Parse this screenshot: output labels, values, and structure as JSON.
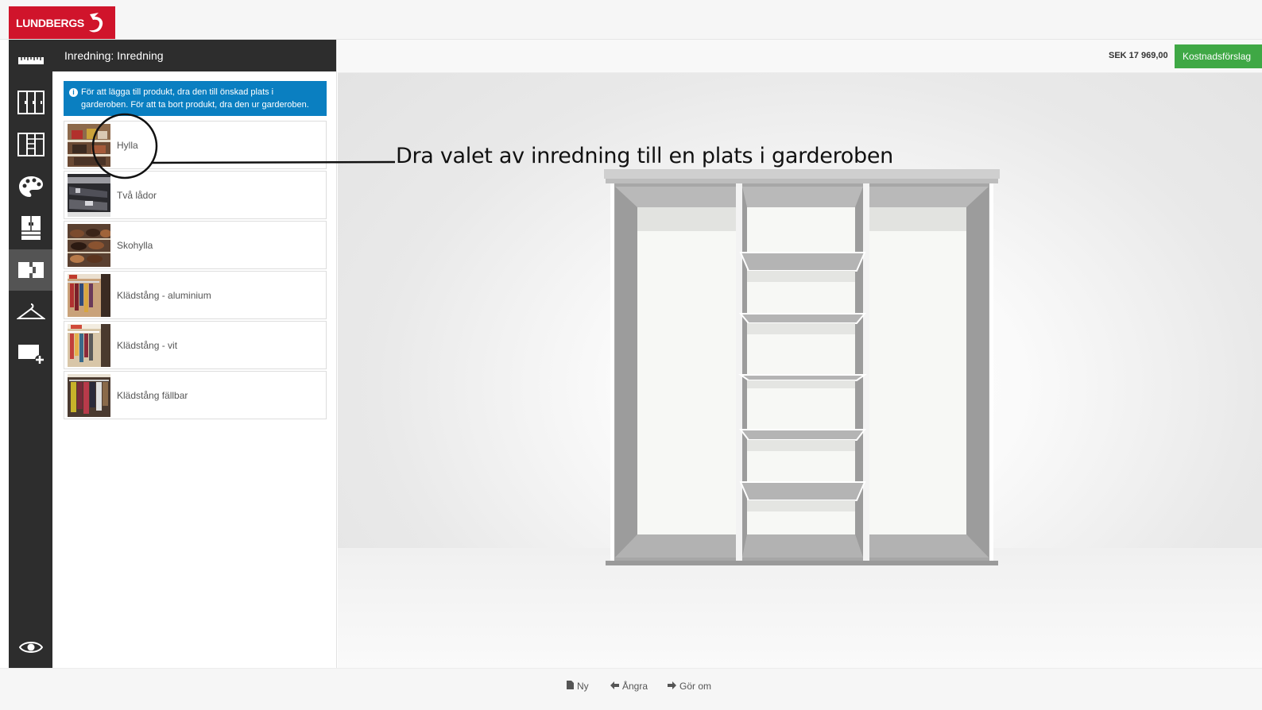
{
  "brand": {
    "name": "LUNDBERGS"
  },
  "rail": {
    "items": [
      {
        "icon": "ruler-icon"
      },
      {
        "icon": "doors-icon"
      },
      {
        "icon": "frame-icon"
      },
      {
        "icon": "palette-icon"
      },
      {
        "icon": "cabinet-icon"
      },
      {
        "icon": "interior-icon",
        "active": true
      },
      {
        "icon": "hanger-icon"
      },
      {
        "icon": "add-panel-icon"
      }
    ],
    "bottom_icon": "eye-icon"
  },
  "panel": {
    "title": "Inredning: Inredning",
    "info_text": "För att lägga till produkt, dra den till önskad plats i garderoben. För att ta bort produkt, dra den ur garderoben.",
    "items": [
      {
        "label": "Hylla"
      },
      {
        "label": "Två lådor"
      },
      {
        "label": "Skohylla"
      },
      {
        "label": "Klädstång - aluminium"
      },
      {
        "label": "Klädstång - vit"
      },
      {
        "label": "Klädstång fällbar"
      }
    ]
  },
  "header": {
    "price": "SEK 17 969,00",
    "quote_button": "Kostnadsförslag"
  },
  "annotation": {
    "text": "Dra valet av inredning till en plats i garderoben"
  },
  "footer": {
    "new_label": "Ny",
    "undo_label": "Ångra",
    "redo_label": "Gör om"
  },
  "colors": {
    "brand_red": "#d0142b",
    "info_blue": "#0a7fc1",
    "quote_green": "#3fa845",
    "rail_dark": "#2d2d2d"
  }
}
